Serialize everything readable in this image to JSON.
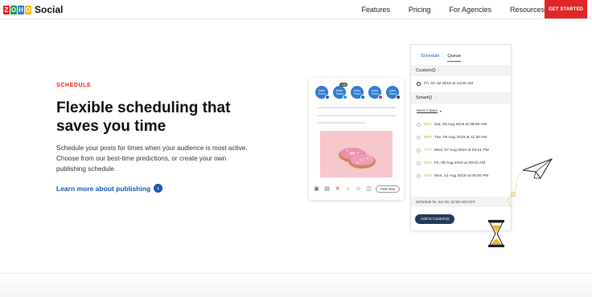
{
  "brand": {
    "logo_letters": [
      "Z",
      "O",
      "H",
      "O"
    ],
    "logo_colors": [
      "#e42527",
      "#1a9b4b",
      "#2f7cd0",
      "#f5b400"
    ],
    "product_name": "Social"
  },
  "nav": {
    "links": [
      "Features",
      "Pricing",
      "For Agencies",
      "Resources"
    ],
    "cta": "GET STARTED",
    "cta_color": "#e42527"
  },
  "hero": {
    "eyebrow": "SCHEDULE",
    "headline": "Flexible scheduling that saves you time",
    "description": "Schedule your posts for times when your audience is most active. Choose from our best-time predictions, or create your own publishing schedule.",
    "learn_more": "Learn more about publishing",
    "accent_color": "#1a56b8"
  },
  "composer": {
    "avatar_text": "Zylker Travel",
    "avatar_count": "+25",
    "post_now": "Post Now"
  },
  "schedule_panel": {
    "tabs": [
      "Schedule",
      "Queue"
    ],
    "active_tab": "Queue",
    "customq_label": "CustomQ",
    "customq_slot": "Fri, 02 Jul 2019 at 10:00 AM",
    "smartq_label": "SmartQ",
    "range_label": "Next 7 days",
    "smart_slots": [
      {
        "pct": "93%",
        "time": "Sat, 03 Aug 2019 at 08:00 AM"
      },
      {
        "pct": "80%",
        "time": "Tue, 06 Aug 2019 at 11:30 AM"
      },
      {
        "pct": "77%",
        "time": "Wed, 07 Aug 2019 at 03:21 PM"
      },
      {
        "pct": "63%",
        "time": "Fri, 09 Aug 2019 at 09:02 AM"
      },
      {
        "pct": "52%",
        "time": "Mon, 12 Aug 2019 at 05:50 PM"
      }
    ],
    "schedule_note": "Schedule for Jun 03, 02:00 AM CDT",
    "add_button": "Add to CustomQ"
  }
}
